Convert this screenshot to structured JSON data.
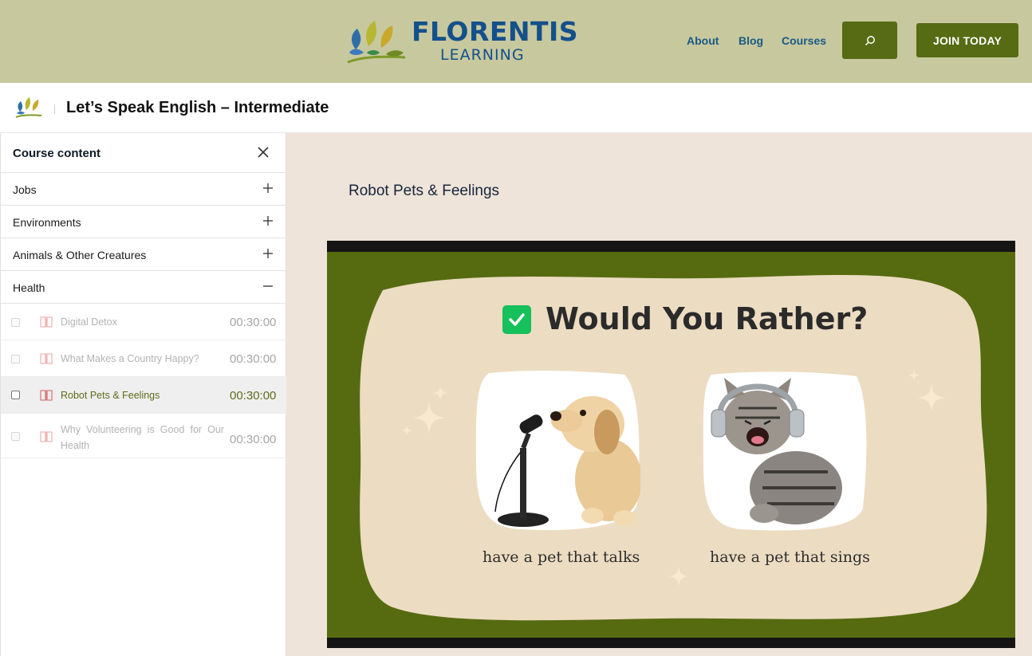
{
  "site": {
    "brand_top": "FLORENTIS",
    "brand_bottom": "LEARNING",
    "nav": [
      "About",
      "Blog",
      "Courses"
    ],
    "join_label": "JOIN TODAY"
  },
  "course": {
    "title": "Let’s Speak English – Intermediate"
  },
  "sidebar": {
    "title": "Course content",
    "sections": [
      {
        "label": "Jobs",
        "toggle": "+"
      },
      {
        "label": "Environments",
        "toggle": "+"
      },
      {
        "label": "Animals & Other Creatures",
        "toggle": "+"
      },
      {
        "label": "Health",
        "toggle": "–"
      }
    ],
    "lessons": [
      {
        "name": "Digital Detox",
        "time": "00:30:00"
      },
      {
        "name": "What Makes a Country Happy?",
        "time": "00:30:00"
      },
      {
        "name": "Robot Pets & Feelings",
        "time": "00:30:00"
      },
      {
        "name": "Why Volunteering is Good for Our Health",
        "time": "00:30:00"
      }
    ]
  },
  "main": {
    "lesson_title": "Robot Pets & Feelings",
    "slide": {
      "title": "Would You Rather?",
      "option_left": "have a pet that talks",
      "option_right": "have a pet that sings"
    }
  },
  "colors": {
    "header_bg": "#c7c89e",
    "accent_green": "#566b14",
    "brand_blue": "#14508a",
    "active_lesson": "#5d6b18"
  }
}
